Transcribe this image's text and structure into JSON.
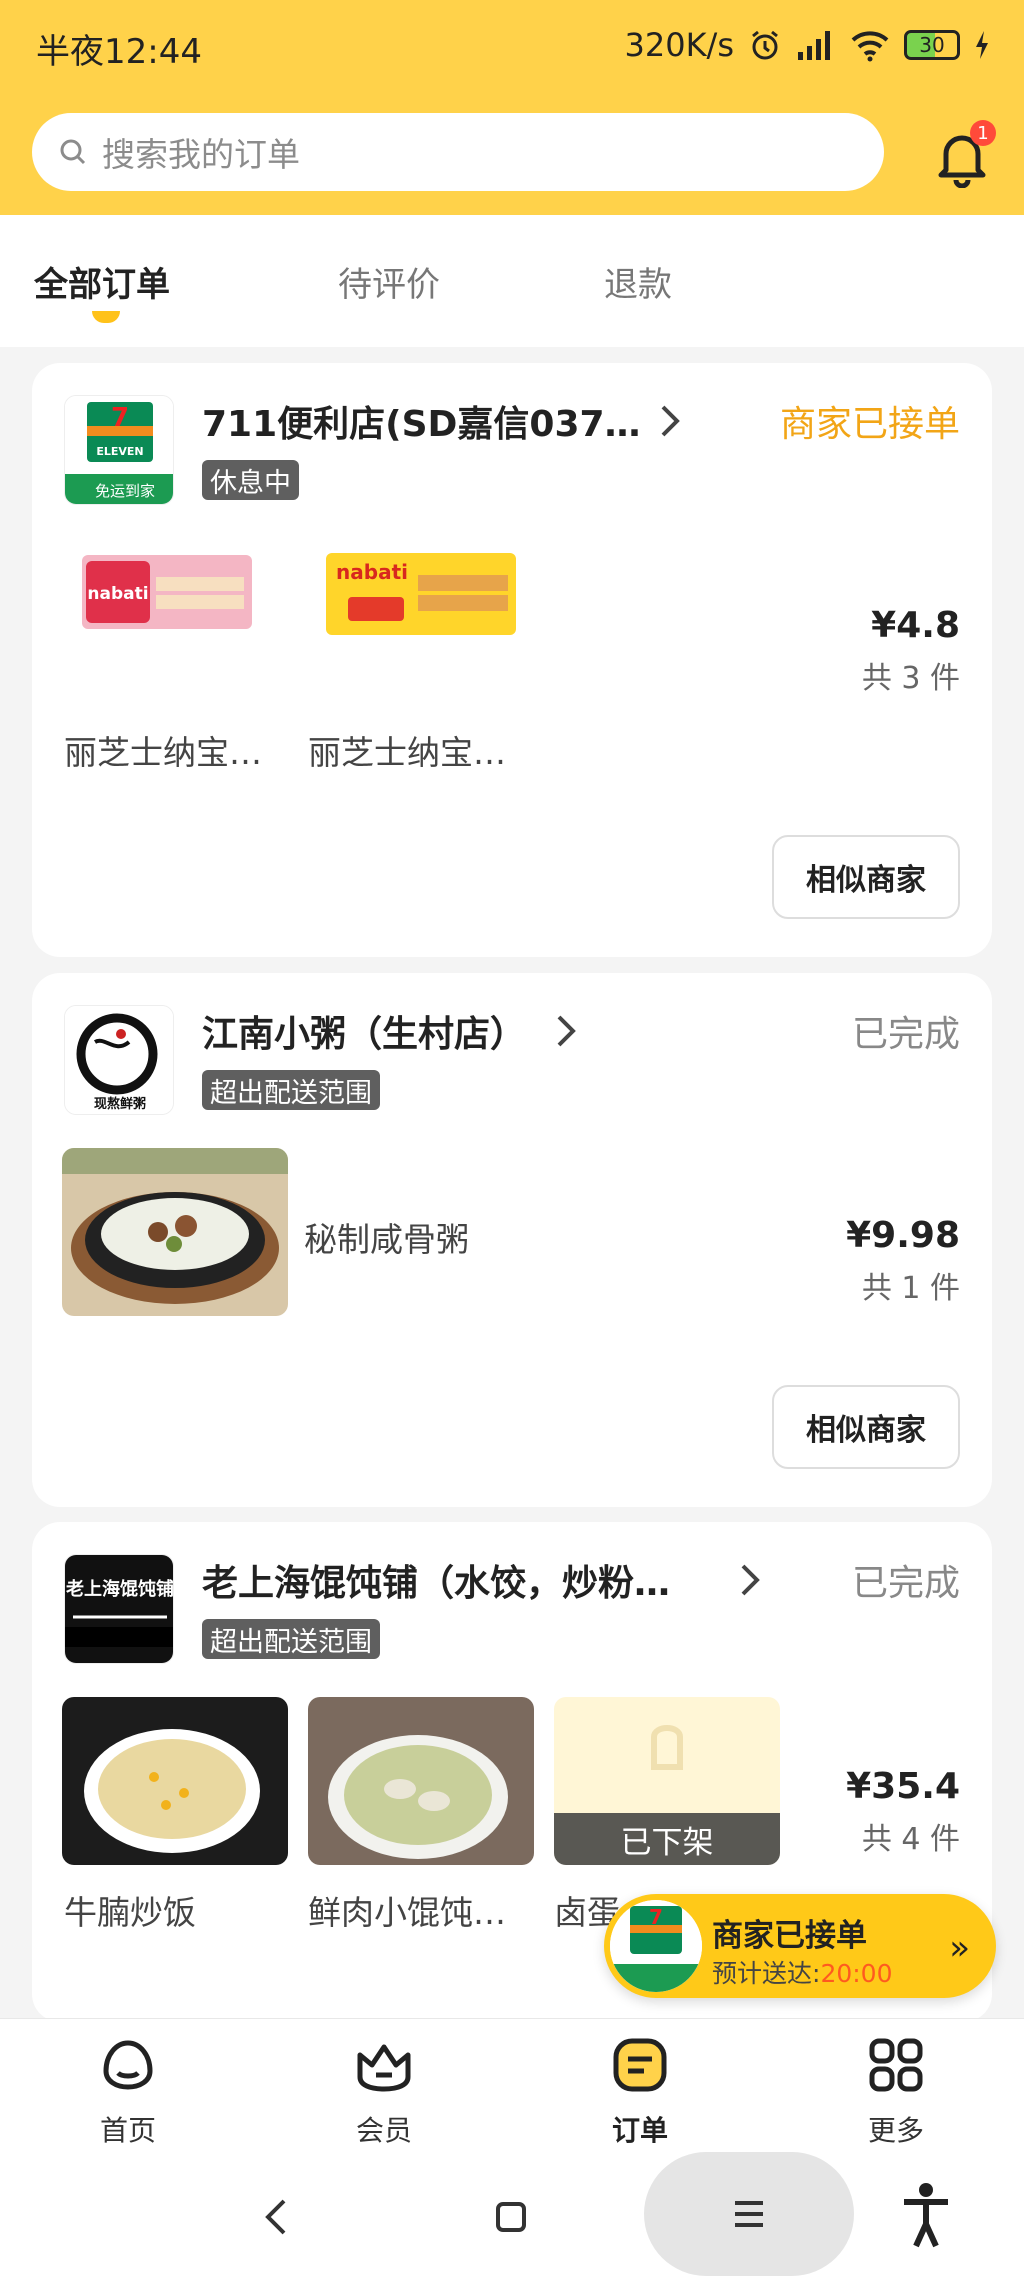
{
  "status_bar": {
    "time": "半夜12:44",
    "speed": "320K/s",
    "battery": "30"
  },
  "search": {
    "placeholder": "搜索我的订单"
  },
  "notifications": {
    "badge": "1"
  },
  "tabs": [
    {
      "label": "全部订单",
      "active": true
    },
    {
      "label": "待评价",
      "active": false
    },
    {
      "label": "退款",
      "active": false
    }
  ],
  "orders": [
    {
      "store": "711便利店(SD嘉信037…",
      "status": "商家已接单",
      "tag": "休息中",
      "items": [
        "丽芝士纳宝…",
        "丽芝士纳宝…"
      ],
      "price": "¥4.8",
      "qty": "共 3 件",
      "button": "相似商家",
      "logo_text": "免运到家"
    },
    {
      "store": "江南小粥（生村店）",
      "status": "已完成",
      "tag": "超出配送范围",
      "items": [
        "秘制咸骨粥"
      ],
      "price": "¥9.98",
      "qty": "共 1 件",
      "button": "相似商家",
      "logo_text": "现熬鲜粥"
    },
    {
      "store": "老上海馄饨铺（水饺，炒粉…",
      "status": "已完成",
      "tag": "超出配送范围",
      "items": [
        "牛腩炒饭",
        "鲜肉小馄饨…",
        "卤蛋"
      ],
      "unavailable": "已下架",
      "price": "¥35.4",
      "qty": "共 4 件",
      "logo_text": "老上海馄饨铺"
    }
  ],
  "floating": {
    "title": "商家已接单",
    "eta_label": "预计送达:",
    "eta_time": "20:00",
    "arrow": "»"
  },
  "bottom_nav": [
    {
      "label": "首页",
      "icon": "home-icon"
    },
    {
      "label": "会员",
      "icon": "member-icon"
    },
    {
      "label": "订单",
      "icon": "orders-icon",
      "active": true
    },
    {
      "label": "更多",
      "icon": "more-icon"
    }
  ],
  "colors": {
    "brand": "#ffd24a",
    "accent": "#f2a516",
    "eta": "#ff5a1f"
  }
}
